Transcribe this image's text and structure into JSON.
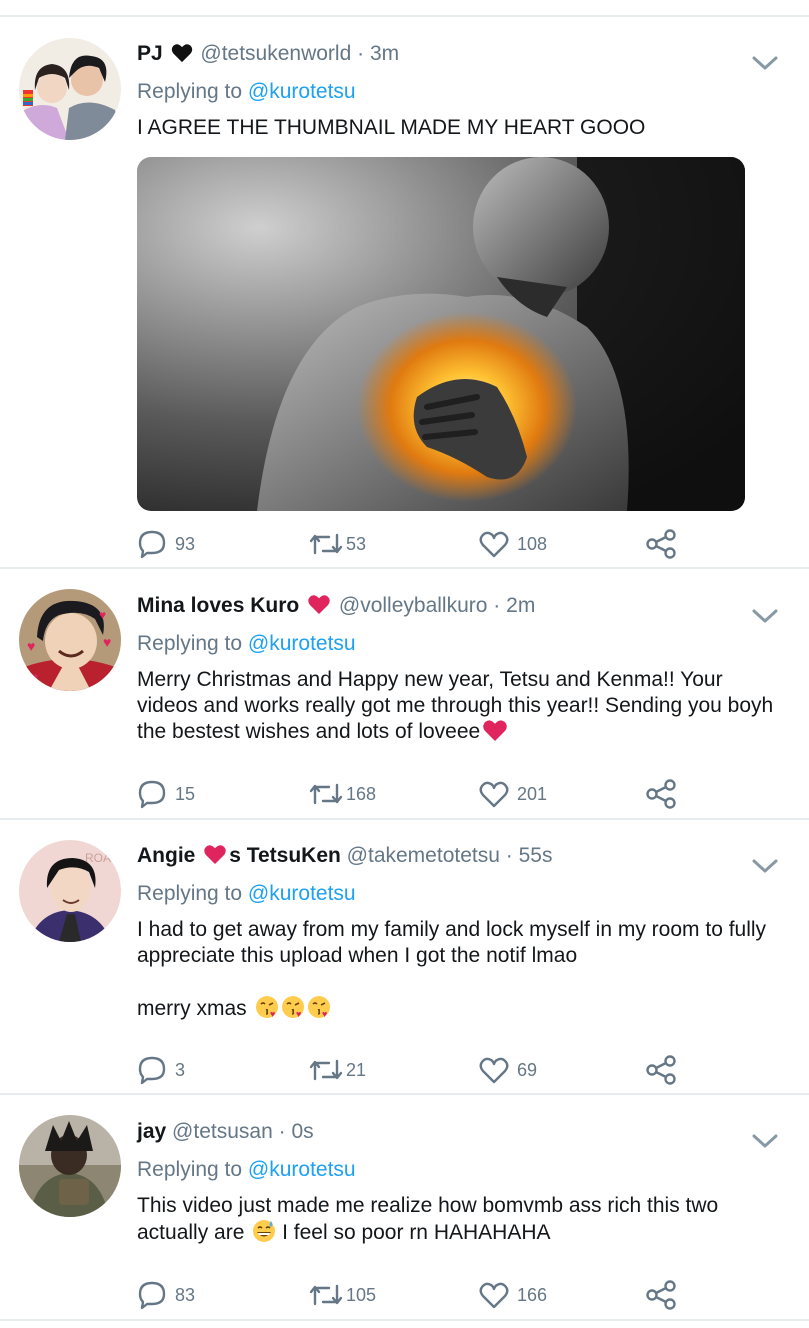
{
  "tweets": [
    {
      "name": "PJ",
      "name_suffix": "",
      "name_heart": "black",
      "handle": "@tetsukenworld",
      "time": "3m",
      "replying_label": "Replying to",
      "replying_to": "@kurotetsu",
      "text_lines": [
        "I AGREE THE THUMBNAIL MADE MY HEART GOOO"
      ],
      "replies": "93",
      "retweets": "53",
      "likes": "108"
    },
    {
      "name": "Mina loves Kuro",
      "name_suffix": "",
      "name_heart": "red",
      "handle": "@volleyballkuro",
      "time": "2m",
      "replying_label": "Replying to",
      "replying_to": "@kurotetsu",
      "text_lines": [
        "Merry Christmas and Happy new year, Tetsu and Kenma!! Your videos and works really got me through this year!! Sending you boyh the bestest wishes and lots of loveee"
      ],
      "replies": "15",
      "retweets": "168",
      "likes": "201"
    },
    {
      "name": "Angie",
      "name_suffix": "s TetsuKen",
      "name_heart": "red",
      "handle": "@takemetotetsu",
      "time": "55s",
      "replying_label": "Replying to",
      "replying_to": "@kurotetsu",
      "text_lines": [
        "I had to get away from my family and lock myself in my room to fully appreciate this upload when I got the notif lmao",
        "merry xmas"
      ],
      "replies": "3",
      "retweets": "21",
      "likes": "69"
    },
    {
      "name": "jay",
      "name_suffix": "",
      "name_heart": "",
      "handle": "@tetsusan",
      "time": "0s",
      "replying_label": "Replying to",
      "replying_to": "@kurotetsu",
      "text_lines": [
        "This video just made me realize how bomvmb ass rich this two actually are",
        "I feel so poor rn HAHAHAHA"
      ],
      "replies": "83",
      "retweets": "105",
      "likes": "166"
    }
  ],
  "icons": {
    "reply": "speech-bubble-icon",
    "retweet": "retweet-icon",
    "like": "heart-outline-icon",
    "share": "share-icon",
    "more": "chevron-down-icon"
  },
  "colors": {
    "link": "#1da1f2",
    "secondary": "#657786",
    "divider": "#e6ecf0",
    "heart_red": "#e0245e"
  }
}
